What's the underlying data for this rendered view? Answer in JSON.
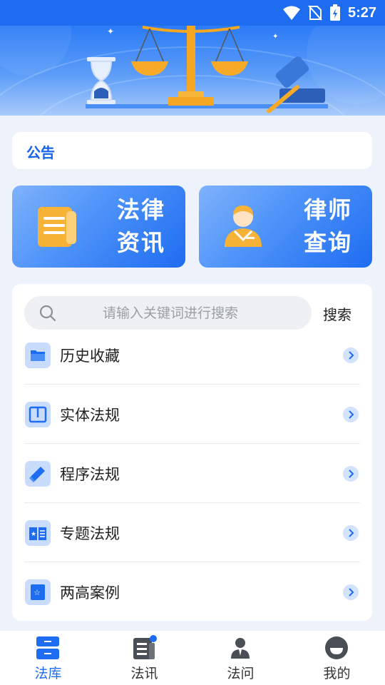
{
  "status_bar": {
    "time": "5:27"
  },
  "notice": {
    "title": "公告"
  },
  "cards": [
    {
      "line1": "法律",
      "line2": "资讯",
      "icon": "document-icon"
    },
    {
      "line1": "律师",
      "line2": "查询",
      "icon": "lawyer-icon"
    }
  ],
  "search": {
    "placeholder": "请输入关键词进行搜索",
    "button_label": "搜索"
  },
  "list": [
    {
      "label": "历史收藏",
      "icon": "folder-icon"
    },
    {
      "label": "实体法规",
      "icon": "book-open-icon"
    },
    {
      "label": "程序法规",
      "icon": "book-stack-icon"
    },
    {
      "label": "专题法规",
      "icon": "star-book-icon"
    },
    {
      "label": "两高案例",
      "icon": "star-bookmark-icon"
    }
  ],
  "bottom_nav": [
    {
      "label": "法库",
      "icon": "law-library-icon",
      "active": true
    },
    {
      "label": "法讯",
      "icon": "news-icon",
      "badge": true
    },
    {
      "label": "法问",
      "icon": "consult-icon"
    },
    {
      "label": "我的",
      "icon": "profile-icon"
    }
  ],
  "colors": {
    "primary": "#1e6cf0",
    "card_gradient_end": "#1f6cf1",
    "page_bg": "#eef3fb"
  }
}
